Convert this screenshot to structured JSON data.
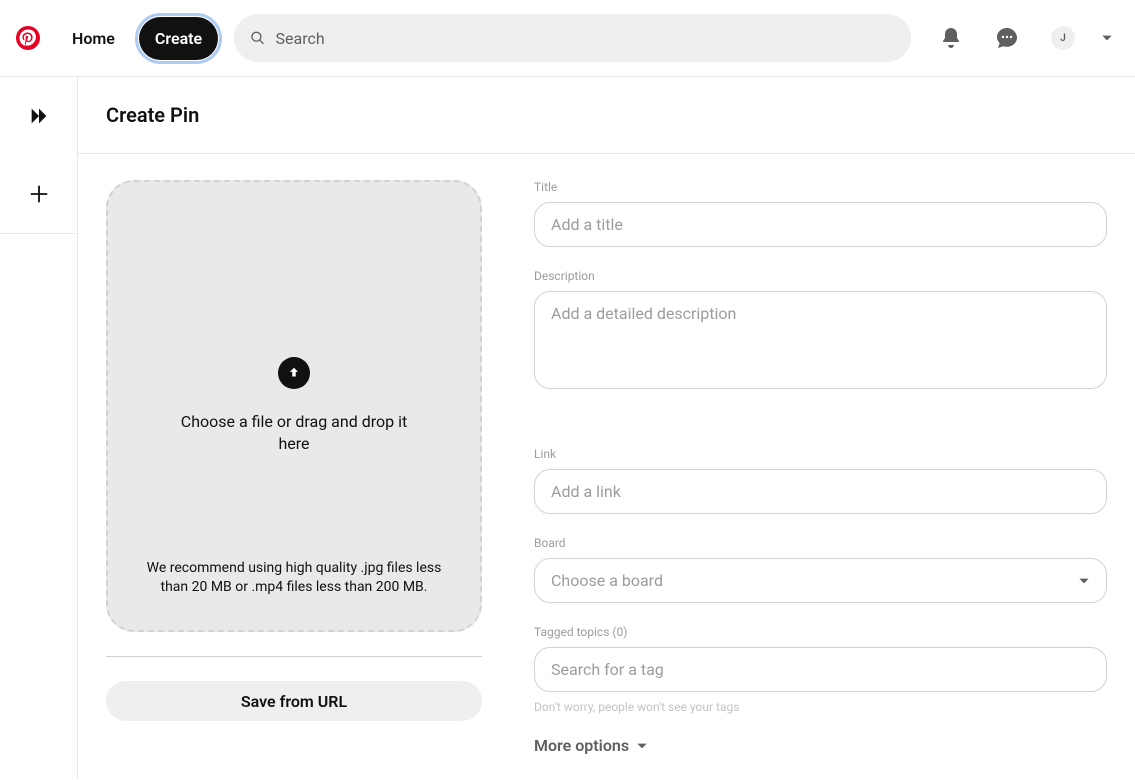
{
  "header": {
    "nav": {
      "home": "Home",
      "create": "Create"
    },
    "search_placeholder": "Search",
    "avatar_initial": "J"
  },
  "page": {
    "title": "Create Pin"
  },
  "upload": {
    "drop_text": "Choose a file or drag and drop it here",
    "recommend_text": "We recommend using high quality .jpg files less than 20 MB or .mp4 files less than 200 MB.",
    "save_url_button": "Save from URL"
  },
  "form": {
    "title": {
      "label": "Title",
      "placeholder": "Add a title"
    },
    "description": {
      "label": "Description",
      "placeholder": "Add a detailed description"
    },
    "link": {
      "label": "Link",
      "placeholder": "Add a link"
    },
    "board": {
      "label": "Board",
      "placeholder": "Choose a board"
    },
    "tags": {
      "label": "Tagged topics (0)",
      "placeholder": "Search for a tag",
      "helper": "Don't worry, people won't see your tags"
    },
    "more_options": "More options"
  }
}
